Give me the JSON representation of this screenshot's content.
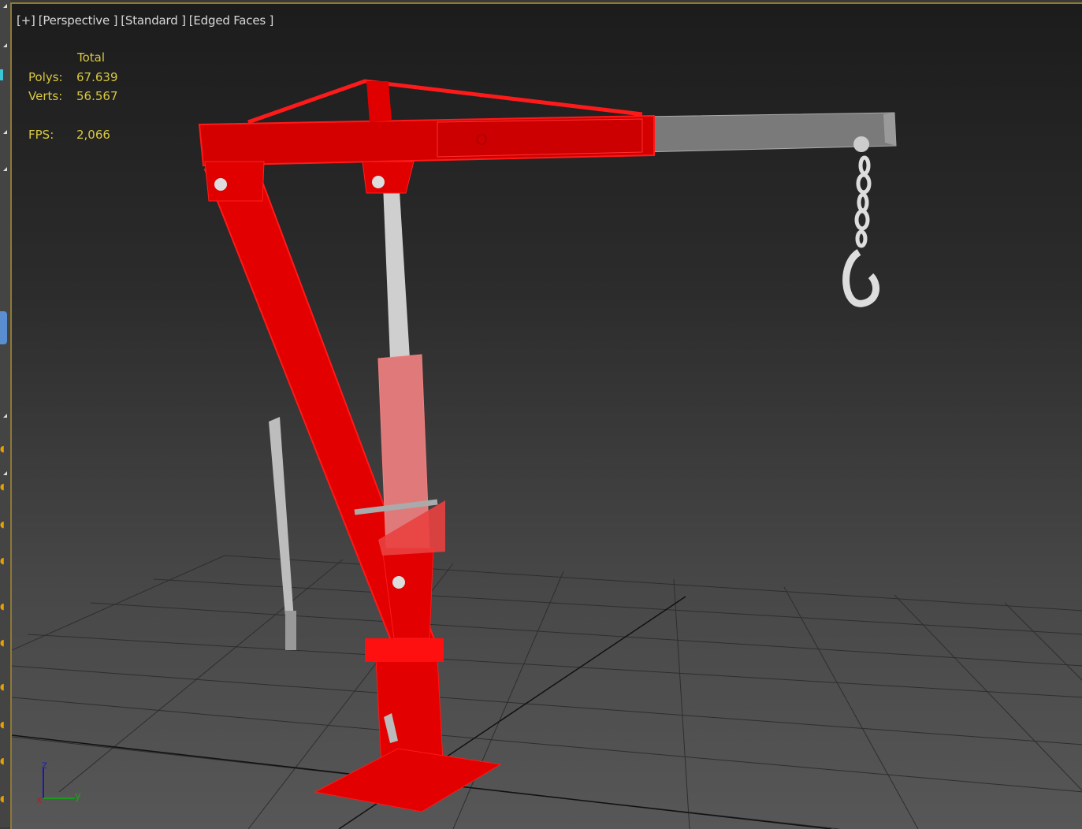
{
  "viewport": {
    "labels": [
      "[+]",
      "[Perspective ]",
      "[Standard ]",
      "[Edged Faces ]"
    ],
    "stats": {
      "header": "Total",
      "polys_label": "Polys:",
      "polys_value": "67.639",
      "verts_label": "Verts:",
      "verts_value": "56.567",
      "fps_label": "FPS:",
      "fps_value": "2,066"
    },
    "axis": {
      "z": "z",
      "y": "y",
      "x": "x"
    }
  },
  "colors": {
    "selection": "#ff0000",
    "stats": "#d8c840",
    "border": "#8d7a34"
  }
}
